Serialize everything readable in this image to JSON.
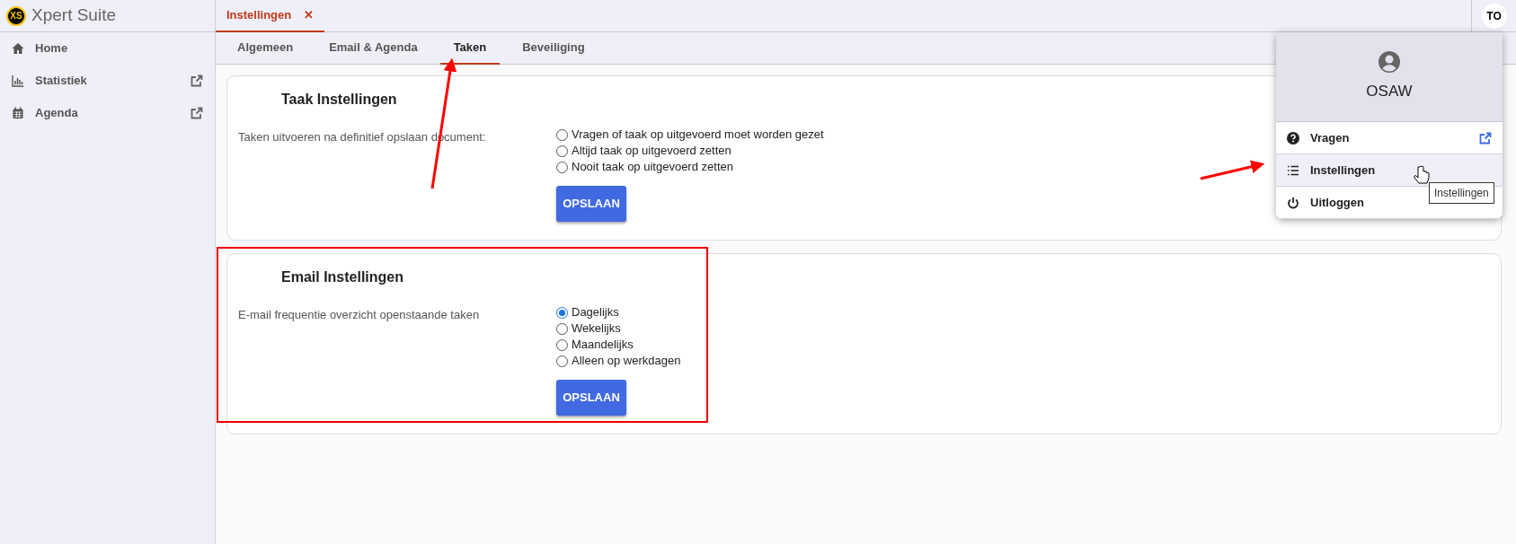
{
  "app": {
    "logo": "XS",
    "title": "Xpert Suite"
  },
  "sidebar": {
    "items": [
      {
        "label": "Home",
        "external": false
      },
      {
        "label": "Statistiek",
        "external": true
      },
      {
        "label": "Agenda",
        "external": true
      }
    ]
  },
  "open_tabs": [
    {
      "label": "Instellingen",
      "selected": true,
      "close": "✕"
    }
  ],
  "user_avatar": "TO",
  "tabs": [
    {
      "label": "Algemeen",
      "selected": false
    },
    {
      "label": "Email & Agenda",
      "selected": false
    },
    {
      "label": "Taken",
      "selected": true
    },
    {
      "label": "Beveiliging",
      "selected": false
    }
  ],
  "cards": [
    {
      "title": "Taak Instellingen",
      "label": "Taken uitvoeren na definitief opslaan document:",
      "options": [
        {
          "label": "Vragen of taak op uitgevoerd moet worden gezet",
          "selected": false
        },
        {
          "label": "Altijd taak op uitgevoerd zetten",
          "selected": false
        },
        {
          "label": "Nooit taak op uitgevoerd zetten",
          "selected": false
        }
      ],
      "button": "OPSLAAN"
    },
    {
      "title": "Email Instellingen",
      "label": "E-mail frequentie overzicht openstaande taken",
      "options": [
        {
          "label": "Dagelijks",
          "selected": true
        },
        {
          "label": "Wekelijks",
          "selected": false
        },
        {
          "label": "Maandelijks",
          "selected": false
        },
        {
          "label": "Alleen op werkdagen",
          "selected": false
        }
      ],
      "button": "OPSLAAN"
    }
  ],
  "user_menu": {
    "name": "OSAW",
    "items": [
      {
        "label": "Vragen",
        "hovered": false,
        "external": true
      },
      {
        "label": "Instellingen",
        "hovered": true,
        "external": false
      },
      {
        "label": "Uitloggen",
        "hovered": false,
        "external": false
      }
    ],
    "tooltip": "Instellingen"
  }
}
